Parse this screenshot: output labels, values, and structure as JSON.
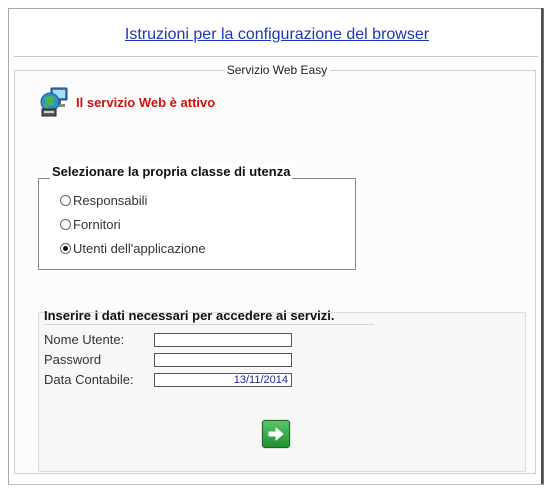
{
  "header": {
    "link_text": "Istruzioni per la configurazione del browser"
  },
  "main_group": {
    "legend": "Servizio Web Easy"
  },
  "status": {
    "text": "Il servizio Web è attivo",
    "icon": "network-computer-icon",
    "color": "#cc1111"
  },
  "user_class": {
    "legend": "Selezionare la propria classe di utenza",
    "options": [
      {
        "label": "Responsabili",
        "checked": false
      },
      {
        "label": "Fornitori",
        "checked": false
      },
      {
        "label": "Utenti dell'applicazione",
        "checked": true
      }
    ]
  },
  "login": {
    "legend": "Inserire i dati necessari per accedere ai servizi.",
    "username_label": "Nome Utente:",
    "username_value": "",
    "password_label": "Password",
    "password_value": "",
    "date_label": "Data Contabile:",
    "date_value": "13/11/2014",
    "submit_icon": "arrow-right-icon"
  },
  "colors": {
    "link": "#1f36b8",
    "status": "#cc1111",
    "button": "#2a9a3a"
  }
}
